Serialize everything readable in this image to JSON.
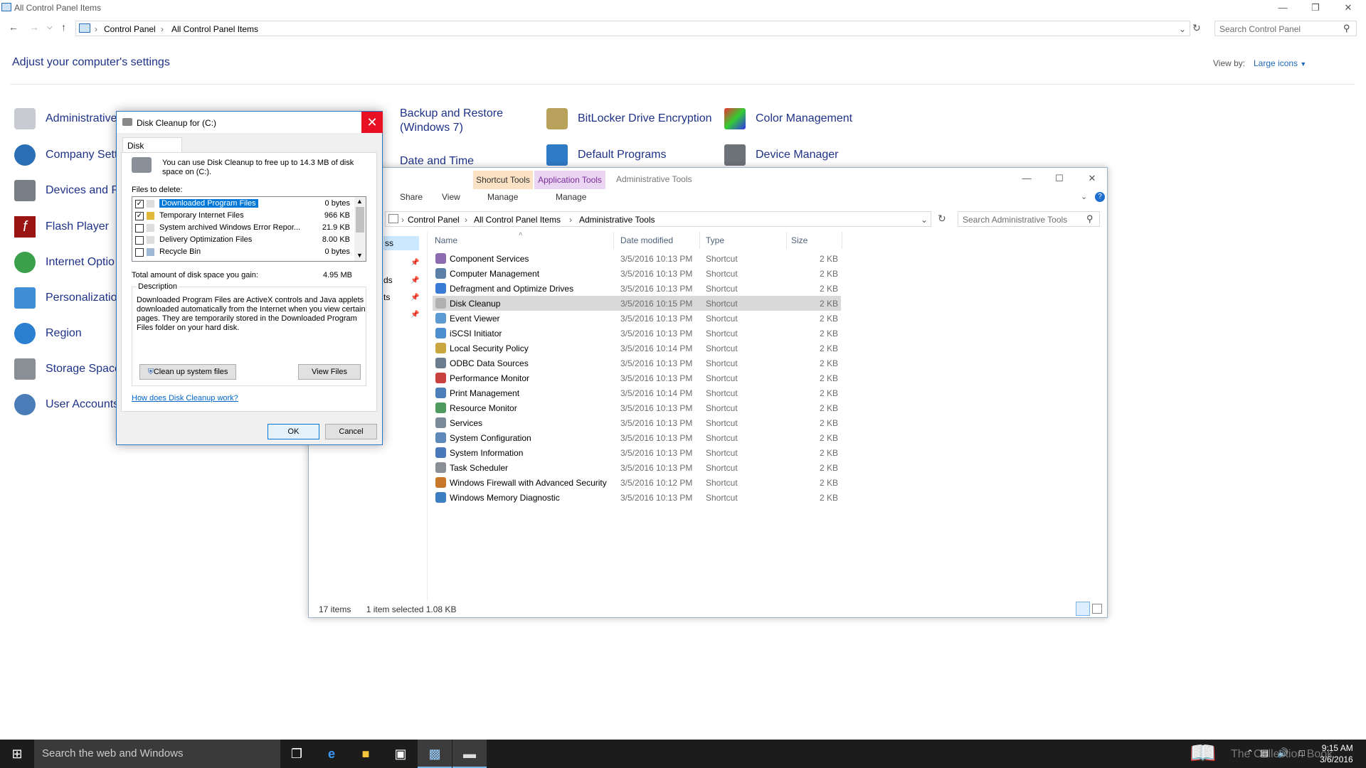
{
  "control_panel": {
    "window_title": "All Control Panel Items",
    "breadcrumb": [
      "Control Panel",
      "All Control Panel Items"
    ],
    "search_placeholder": "Search Control Panel",
    "heading": "Adjust your computer's settings",
    "view_by_label": "View by:",
    "view_by_value": "Large icons",
    "items_col1": [
      "Administrative Tools",
      "Company Settings",
      "Devices and Printers",
      "Flash Player",
      "Internet Options",
      "Personalization",
      "Region",
      "Storage Spaces",
      "User Accounts"
    ],
    "items_visible_col1": [
      "Administrative",
      "Company Setti",
      "Devices and Pr",
      "Flash Player",
      "Internet Optio",
      "Personalizatio",
      "Region",
      "Storage Spaces",
      "User Accounts"
    ],
    "items_col3": [
      "Backup and Restore",
      "(Windows 7)",
      "Date and Time"
    ],
    "items_col4": [
      "BitLocker Drive Encryption",
      "Default Programs"
    ],
    "items_col5": [
      "Color Management",
      "Device Manager"
    ]
  },
  "explorer": {
    "title": "Administrative Tools",
    "ctx_tab1": "Shortcut Tools",
    "ctx_tab2": "Application Tools",
    "tab_share": "Share",
    "tab_view": "View",
    "tab_manage1": "Manage",
    "tab_manage2": "Manage",
    "breadcrumb": [
      "Control Panel",
      "All Control Panel Items",
      "Administrative Tools"
    ],
    "search_placeholder": "Search Administrative Tools",
    "columns": {
      "name": "Name",
      "date": "Date modified",
      "type": "Type",
      "size": "Size"
    },
    "nav_fragments": [
      "ss",
      "ds",
      "ts"
    ],
    "files": [
      {
        "name": "Component Services",
        "date": "3/5/2016 10:13 PM",
        "type": "Shortcut",
        "size": "2 KB"
      },
      {
        "name": "Computer Management",
        "date": "3/5/2016 10:13 PM",
        "type": "Shortcut",
        "size": "2 KB"
      },
      {
        "name": "Defragment and Optimize Drives",
        "date": "3/5/2016 10:13 PM",
        "type": "Shortcut",
        "size": "2 KB"
      },
      {
        "name": "Disk Cleanup",
        "date": "3/5/2016 10:15 PM",
        "type": "Shortcut",
        "size": "2 KB"
      },
      {
        "name": "Event Viewer",
        "date": "3/5/2016 10:13 PM",
        "type": "Shortcut",
        "size": "2 KB"
      },
      {
        "name": "iSCSI Initiator",
        "date": "3/5/2016 10:13 PM",
        "type": "Shortcut",
        "size": "2 KB"
      },
      {
        "name": "Local Security Policy",
        "date": "3/5/2016 10:14 PM",
        "type": "Shortcut",
        "size": "2 KB"
      },
      {
        "name": "ODBC Data Sources",
        "date": "3/5/2016 10:13 PM",
        "type": "Shortcut",
        "size": "2 KB"
      },
      {
        "name": "Performance Monitor",
        "date": "3/5/2016 10:13 PM",
        "type": "Shortcut",
        "size": "2 KB"
      },
      {
        "name": "Print Management",
        "date": "3/5/2016 10:14 PM",
        "type": "Shortcut",
        "size": "2 KB"
      },
      {
        "name": "Resource Monitor",
        "date": "3/5/2016 10:13 PM",
        "type": "Shortcut",
        "size": "2 KB"
      },
      {
        "name": "Services",
        "date": "3/5/2016 10:13 PM",
        "type": "Shortcut",
        "size": "2 KB"
      },
      {
        "name": "System Configuration",
        "date": "3/5/2016 10:13 PM",
        "type": "Shortcut",
        "size": "2 KB"
      },
      {
        "name": "System Information",
        "date": "3/5/2016 10:13 PM",
        "type": "Shortcut",
        "size": "2 KB"
      },
      {
        "name": "Task Scheduler",
        "date": "3/5/2016 10:13 PM",
        "type": "Shortcut",
        "size": "2 KB"
      },
      {
        "name": "Windows Firewall with Advanced Security",
        "date": "3/5/2016 10:12 PM",
        "type": "Shortcut",
        "size": "2 KB"
      },
      {
        "name": "Windows Memory Diagnostic",
        "date": "3/5/2016 10:13 PM",
        "type": "Shortcut",
        "size": "2 KB"
      }
    ],
    "selected_index": 3,
    "status_items": "17 items",
    "status_selected": "1 item selected  1.08 KB"
  },
  "disk_cleanup": {
    "title": "Disk Cleanup for  (C:)",
    "tab": "Disk Cleanup",
    "intro_line1": "You can use Disk Cleanup to free up to 14.3 MB of disk",
    "intro_line2": "space on  (C:).",
    "files_label": "Files to delete:",
    "files": [
      {
        "name": "Downloaded Program Files",
        "size": "0 bytes",
        "checked": true
      },
      {
        "name": "Temporary Internet Files",
        "size": "966 KB",
        "checked": true
      },
      {
        "name": "System archived Windows Error Repor...",
        "size": "21.9 KB",
        "checked": false
      },
      {
        "name": "Delivery Optimization Files",
        "size": "8.00 KB",
        "checked": false
      },
      {
        "name": "Recycle Bin",
        "size": "0 bytes",
        "checked": false
      }
    ],
    "total_label": "Total amount of disk space you gain:",
    "total_value": "4.95 MB",
    "description_label": "Description",
    "description_lines": [
      "Downloaded Program Files are ActiveX controls and Java applets",
      "downloaded automatically from the Internet when you view certain",
      "pages. They are temporarily stored in the Downloaded Program",
      "Files folder on your hard disk."
    ],
    "cleanup_system_btn": "Clean up system files",
    "view_files_btn": "View Files",
    "help_link": "How does Disk Cleanup work?",
    "ok_btn": "OK",
    "cancel_btn": "Cancel"
  },
  "taskbar": {
    "search_placeholder": "Search the web and Windows",
    "time": "9:15 AM",
    "date": "3/6/2016",
    "watermark": "The Collection Book"
  },
  "colors": {
    "link": "#1e3287",
    "accent": "#0078d7",
    "close": "#e81123"
  }
}
